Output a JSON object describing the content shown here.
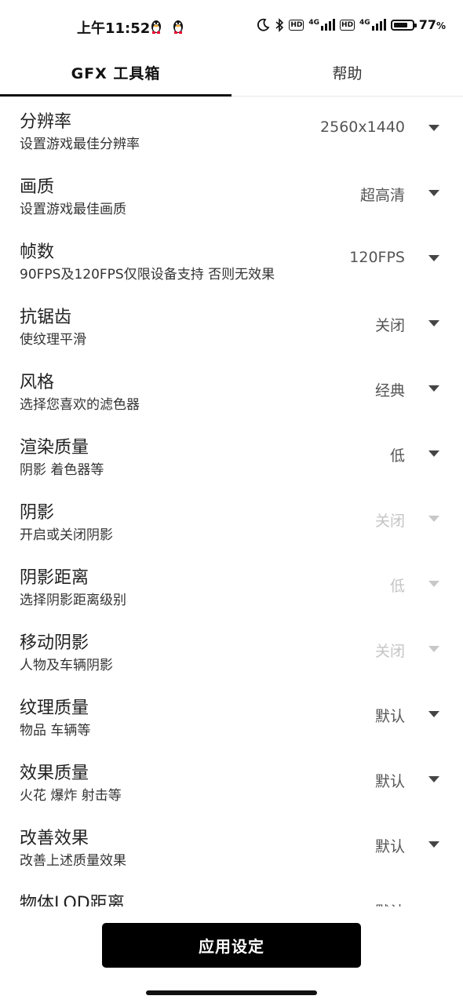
{
  "status_bar": {
    "time": "上午11:52",
    "notif_icons": [
      "qq-penguin-icon",
      "qq-penguin-icon"
    ],
    "network_1": "4G",
    "network_2": "4G",
    "hd_label": "HD",
    "battery_percent": "77",
    "battery_unit": "%",
    "battery_level": 0.77
  },
  "tabs": [
    {
      "label": "GFX 工具箱",
      "active": true
    },
    {
      "label": "帮助",
      "active": false
    }
  ],
  "settings": [
    {
      "title": "分辨率",
      "subtitle": "设置游戏最佳分辨率",
      "value": "2560x1440",
      "enabled": true
    },
    {
      "title": "画质",
      "subtitle": "设置游戏最佳画质",
      "value": "超高清",
      "enabled": true
    },
    {
      "title": "帧数",
      "subtitle": "90FPS及120FPS仅限设备支持 否则无效果",
      "value": "120FPS",
      "enabled": true
    },
    {
      "title": "抗锯齿",
      "subtitle": "使纹理平滑",
      "value": "关闭",
      "enabled": true
    },
    {
      "title": "风格",
      "subtitle": "选择您喜欢的滤色器",
      "value": "经典",
      "enabled": true
    },
    {
      "title": "渲染质量",
      "subtitle": "阴影 着色器等",
      "value": "低",
      "enabled": true
    },
    {
      "title": "阴影",
      "subtitle": "开启或关闭阴影",
      "value": "关闭",
      "enabled": false
    },
    {
      "title": "阴影距离",
      "subtitle": "选择阴影距离级别",
      "value": "低",
      "enabled": false
    },
    {
      "title": "移动阴影",
      "subtitle": "人物及车辆阴影",
      "value": "关闭",
      "enabled": false
    },
    {
      "title": "纹理质量",
      "subtitle": "物品 车辆等",
      "value": "默认",
      "enabled": true
    },
    {
      "title": "效果质量",
      "subtitle": "火花 爆炸 射击等",
      "value": "默认",
      "enabled": true
    },
    {
      "title": "改善效果",
      "subtitle": "改善上述质量效果",
      "value": "默认",
      "enabled": true
    },
    {
      "title": "物体LOD距离",
      "subtitle": "",
      "value": "默认",
      "enabled": true
    }
  ],
  "apply_button": {
    "label": "应用设定"
  }
}
